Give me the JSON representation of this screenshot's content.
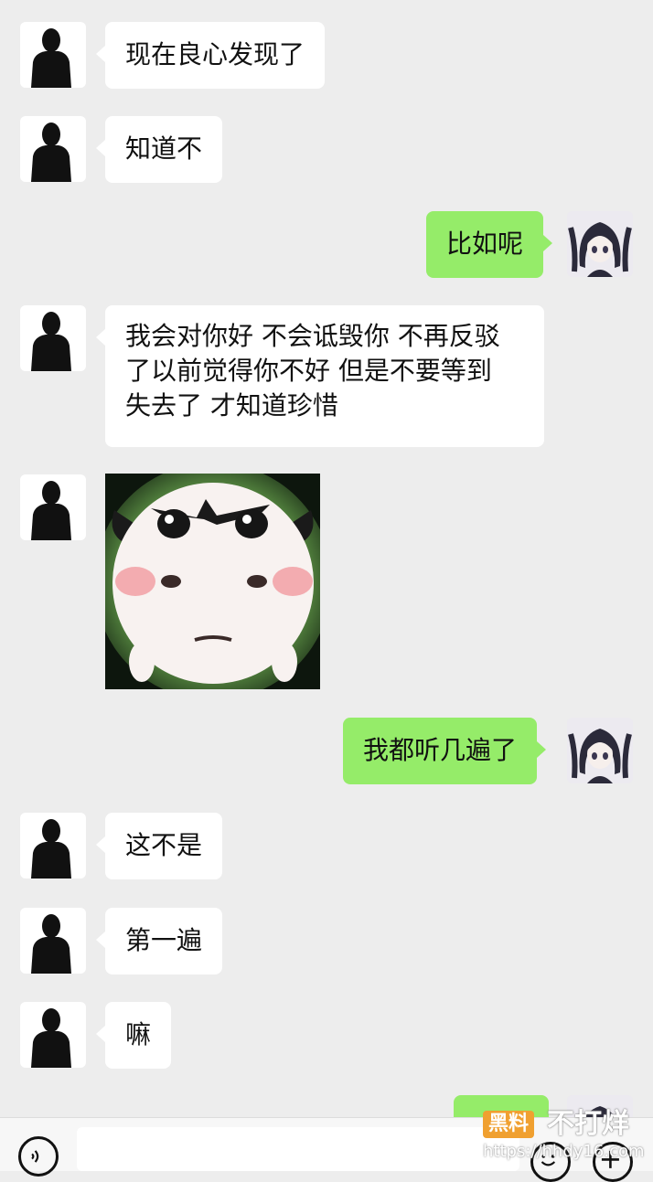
{
  "messages": [
    {
      "side": "in",
      "text": "现在良心发现了"
    },
    {
      "side": "in",
      "text": "知道不"
    },
    {
      "side": "out",
      "text": "比如呢"
    },
    {
      "side": "in",
      "text": "我会对你好 不会诋毁你 不再反驳\n了以前觉得你不好 但是不要等到\n失去了 才知道珍惜"
    },
    {
      "side": "in",
      "type": "sticker",
      "sticker": "angry-cow-sticker"
    },
    {
      "side": "out",
      "text": "我都听几遍了"
    },
    {
      "side": "in",
      "text": "这不是"
    },
    {
      "side": "in",
      "text": "第一遍"
    },
    {
      "side": "in",
      "text": "嘛"
    },
    {
      "side": "out",
      "text": ""
    }
  ],
  "avatars": {
    "contact": "silhouette-avatar",
    "self": "anime-girl-avatar"
  },
  "input_bar": {
    "voice_icon": "voice-icon",
    "emoji_icon": "emoji-icon",
    "plus_icon": "plus-icon"
  },
  "watermark": {
    "badge": "黑料",
    "text": "不打烊",
    "url": "https://hhdy16.com"
  },
  "colors": {
    "background": "#ededed",
    "incoming_bubble": "#ffffff",
    "outgoing_bubble": "#95ec69"
  }
}
